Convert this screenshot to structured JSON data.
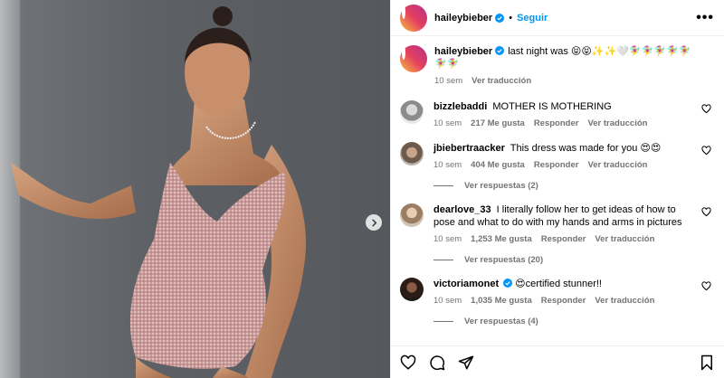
{
  "post": {
    "username": "haileybieber",
    "follow_label": "Seguir",
    "dot": "•",
    "more_label": "•••"
  },
  "caption": {
    "username": "haileybieber",
    "text": "last night was 😝😝✨✨🤍🧚‍♀️🧚‍♀️🧚‍♀️🧚‍♀️🧚‍♀️🧚‍♀️🧚‍♀️",
    "time": "10 sem",
    "translate": "Ver traducción"
  },
  "comments": [
    {
      "username": "bizzlebaddi",
      "verified": false,
      "text": "MOTHER IS MOTHERING",
      "time": "10 sem",
      "likes": "217 Me gusta",
      "reply": "Responder",
      "translate": "Ver traducción",
      "replies": ""
    },
    {
      "username": "jbiebertraacker",
      "verified": false,
      "text": "This dress was made for you 😍😍",
      "time": "10 sem",
      "likes": "404 Me gusta",
      "reply": "Responder",
      "translate": "Ver traducción",
      "replies": "Ver respuestas (2)"
    },
    {
      "username": "dearlove_33",
      "verified": false,
      "text": "I literally follow her to get ideas of how to pose and what to do with my hands and arms in pictures",
      "time": "10 sem",
      "likes": "1,253 Me gusta",
      "reply": "Responder",
      "translate": "Ver traducción",
      "replies": "Ver respuestas (20)"
    },
    {
      "username": "victoriamonet",
      "verified": true,
      "text": "😍certified stunner!!",
      "time": "10 sem",
      "likes": "1,035 Me gusta",
      "reply": "Responder",
      "translate": "Ver traducción",
      "replies": "Ver respuestas (4)"
    }
  ],
  "colors": {
    "accent": "#0095f6",
    "muted": "#737373",
    "border": "#efefef",
    "dress": "#c99a9a"
  },
  "icons": [
    "verified-icon",
    "heart-icon",
    "comment-icon",
    "share-icon",
    "save-icon",
    "chevron-right-icon"
  ]
}
